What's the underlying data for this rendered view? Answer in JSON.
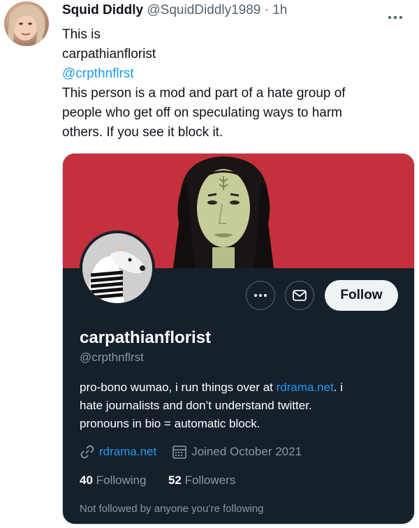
{
  "tweet": {
    "author_name": "Squid Diddly",
    "author_handle": "@SquidDiddly1989",
    "separator": " · ",
    "time": "1h",
    "more_icon": "more-horizontal-icon",
    "lines": {
      "l1": "This is",
      "l2": "carpathianflorist",
      "l3": "@crpthnflrst",
      "l4": "This person is a mod and part of a hate group of",
      "l5": "people who get off on speculating ways to harm",
      "l6": "others. If you see it block it."
    }
  },
  "profile_card": {
    "banner_color": "#c4303c",
    "background_color": "#15202b",
    "more_button_icon": "more-horizontal-icon",
    "message_button_icon": "envelope-icon",
    "follow_label": "Follow",
    "name": "carpathianflorist",
    "handle": "@crpthnflrst",
    "bio": {
      "line1_pre": "pro-bono wumao, i run things over at ",
      "line1_link": "rdrama.net",
      "line1_post": ". i",
      "line2": "hate journalists and don’t understand twitter.",
      "line3": "pronouns in bio = automatic block."
    },
    "website_icon": "link-icon",
    "website": "rdrama.net",
    "calendar_icon": "calendar-icon",
    "joined": "Joined October 2021",
    "following_count": "40",
    "following_label": "Following",
    "followers_count": "52",
    "followers_label": "Followers",
    "not_followed_text": "Not followed by anyone you’re following"
  }
}
